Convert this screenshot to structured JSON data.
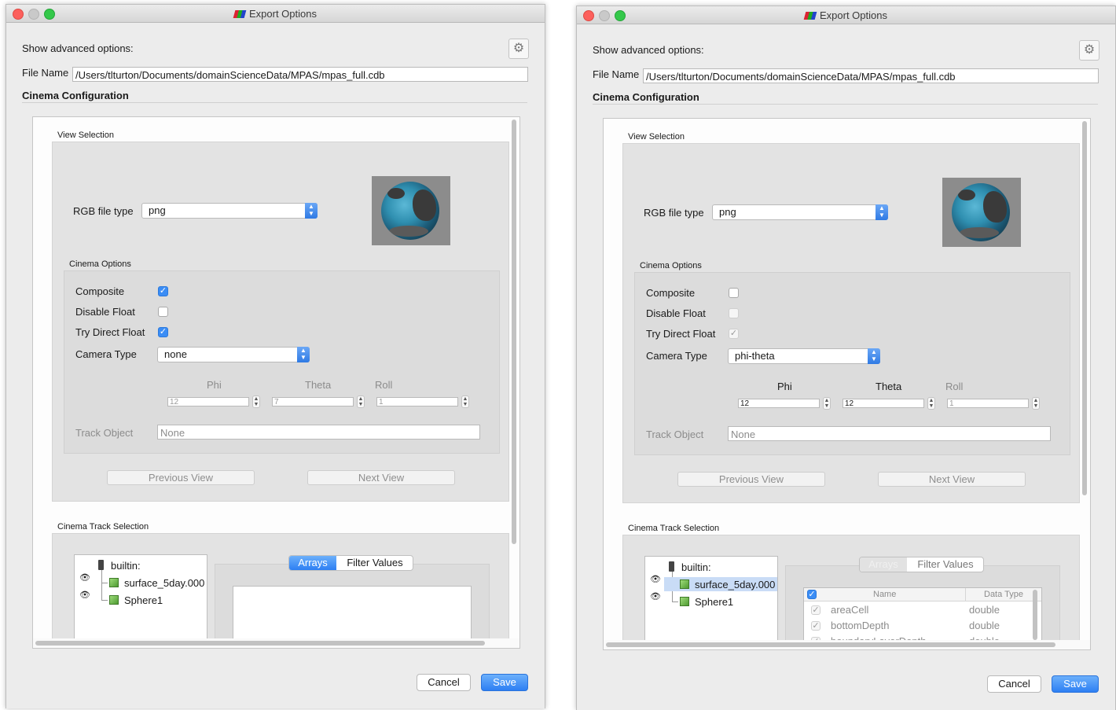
{
  "window_title": "Export Options",
  "left": {
    "show_advanced": "Show advanced options:",
    "file_name_label": "File Name",
    "file_name_value": "/Users/tlturton/Documents/domainScienceData/MPAS/mpas_full.cdb",
    "cinema_config": "Cinema Configuration",
    "view_selection": "View Selection",
    "rgb_label": "RGB file type",
    "rgb_value": "png",
    "cinema_options": "Cinema Options",
    "composite": "Composite",
    "disable_float": "Disable Float",
    "try_direct_float": "Try Direct Float",
    "camera_type_label": "Camera Type",
    "camera_type_value": "none",
    "phi_label": "Phi",
    "theta_label": "Theta",
    "roll_label": "Roll",
    "phi_value": "12",
    "theta_value": "7",
    "roll_value": "1",
    "track_object_label": "Track Object",
    "track_object_value": "None",
    "previous_view": "Previous View",
    "next_view": "Next View",
    "track_selection": "Cinema Track Selection",
    "tree_builtin": "builtin:",
    "tree_item1": "surface_5day.000",
    "tree_item2": "Sphere1",
    "tab_arrays": "Arrays",
    "tab_filter": "Filter Values",
    "cancel": "Cancel",
    "save": "Save",
    "checks": {
      "composite": true,
      "disable_float": false,
      "try_direct_float": true
    }
  },
  "right": {
    "show_advanced": "Show advanced options:",
    "file_name_label": "File Name",
    "file_name_value": "/Users/tlturton/Documents/domainScienceData/MPAS/mpas_full.cdb",
    "cinema_config": "Cinema Configuration",
    "view_selection": "View Selection",
    "rgb_label": "RGB file type",
    "rgb_value": "png",
    "cinema_options": "Cinema Options",
    "composite": "Composite",
    "disable_float": "Disable Float",
    "try_direct_float": "Try Direct Float",
    "camera_type_label": "Camera Type",
    "camera_type_value": "phi-theta",
    "phi_label": "Phi",
    "theta_label": "Theta",
    "roll_label": "Roll",
    "phi_value": "12",
    "theta_value": "12",
    "roll_value": "1",
    "track_object_label": "Track Object",
    "track_object_value": "None",
    "previous_view": "Previous View",
    "next_view": "Next View",
    "track_selection": "Cinema Track Selection",
    "tree_builtin": "builtin:",
    "tree_item1": "surface_5day.000",
    "tree_item2": "Sphere1",
    "tab_arrays": "Arrays",
    "tab_filter": "Filter Values",
    "col_name": "Name",
    "col_type": "Data Type",
    "rows": [
      {
        "name": "areaCell",
        "type": "double"
      },
      {
        "name": "bottomDepth",
        "type": "double"
      },
      {
        "name": "boundaryLayerDepth",
        "type": "double"
      }
    ],
    "cancel": "Cancel",
    "save": "Save",
    "checks": {
      "composite": false,
      "disable_float": false,
      "try_direct_float": true
    }
  },
  "colors": {
    "accent": "#3b8df5",
    "window_bg": "#ececec",
    "group_bg": "#e3e3e3"
  },
  "icons": {
    "gear": "gear-icon",
    "eye": "eye-icon",
    "cube": "cube-icon",
    "server": "server-icon"
  }
}
